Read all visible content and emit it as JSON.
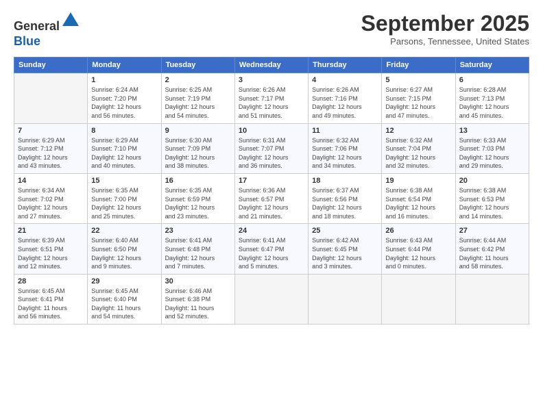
{
  "logo": {
    "line1": "General",
    "line2": "Blue"
  },
  "title": "September 2025",
  "location": "Parsons, Tennessee, United States",
  "days_of_week": [
    "Sunday",
    "Monday",
    "Tuesday",
    "Wednesday",
    "Thursday",
    "Friday",
    "Saturday"
  ],
  "weeks": [
    [
      {
        "day": "",
        "info": ""
      },
      {
        "day": "1",
        "info": "Sunrise: 6:24 AM\nSunset: 7:20 PM\nDaylight: 12 hours\nand 56 minutes."
      },
      {
        "day": "2",
        "info": "Sunrise: 6:25 AM\nSunset: 7:19 PM\nDaylight: 12 hours\nand 54 minutes."
      },
      {
        "day": "3",
        "info": "Sunrise: 6:26 AM\nSunset: 7:17 PM\nDaylight: 12 hours\nand 51 minutes."
      },
      {
        "day": "4",
        "info": "Sunrise: 6:26 AM\nSunset: 7:16 PM\nDaylight: 12 hours\nand 49 minutes."
      },
      {
        "day": "5",
        "info": "Sunrise: 6:27 AM\nSunset: 7:15 PM\nDaylight: 12 hours\nand 47 minutes."
      },
      {
        "day": "6",
        "info": "Sunrise: 6:28 AM\nSunset: 7:13 PM\nDaylight: 12 hours\nand 45 minutes."
      }
    ],
    [
      {
        "day": "7",
        "info": "Sunrise: 6:29 AM\nSunset: 7:12 PM\nDaylight: 12 hours\nand 43 minutes."
      },
      {
        "day": "8",
        "info": "Sunrise: 6:29 AM\nSunset: 7:10 PM\nDaylight: 12 hours\nand 40 minutes."
      },
      {
        "day": "9",
        "info": "Sunrise: 6:30 AM\nSunset: 7:09 PM\nDaylight: 12 hours\nand 38 minutes."
      },
      {
        "day": "10",
        "info": "Sunrise: 6:31 AM\nSunset: 7:07 PM\nDaylight: 12 hours\nand 36 minutes."
      },
      {
        "day": "11",
        "info": "Sunrise: 6:32 AM\nSunset: 7:06 PM\nDaylight: 12 hours\nand 34 minutes."
      },
      {
        "day": "12",
        "info": "Sunrise: 6:32 AM\nSunset: 7:04 PM\nDaylight: 12 hours\nand 32 minutes."
      },
      {
        "day": "13",
        "info": "Sunrise: 6:33 AM\nSunset: 7:03 PM\nDaylight: 12 hours\nand 29 minutes."
      }
    ],
    [
      {
        "day": "14",
        "info": "Sunrise: 6:34 AM\nSunset: 7:02 PM\nDaylight: 12 hours\nand 27 minutes."
      },
      {
        "day": "15",
        "info": "Sunrise: 6:35 AM\nSunset: 7:00 PM\nDaylight: 12 hours\nand 25 minutes."
      },
      {
        "day": "16",
        "info": "Sunrise: 6:35 AM\nSunset: 6:59 PM\nDaylight: 12 hours\nand 23 minutes."
      },
      {
        "day": "17",
        "info": "Sunrise: 6:36 AM\nSunset: 6:57 PM\nDaylight: 12 hours\nand 21 minutes."
      },
      {
        "day": "18",
        "info": "Sunrise: 6:37 AM\nSunset: 6:56 PM\nDaylight: 12 hours\nand 18 minutes."
      },
      {
        "day": "19",
        "info": "Sunrise: 6:38 AM\nSunset: 6:54 PM\nDaylight: 12 hours\nand 16 minutes."
      },
      {
        "day": "20",
        "info": "Sunrise: 6:38 AM\nSunset: 6:53 PM\nDaylight: 12 hours\nand 14 minutes."
      }
    ],
    [
      {
        "day": "21",
        "info": "Sunrise: 6:39 AM\nSunset: 6:51 PM\nDaylight: 12 hours\nand 12 minutes."
      },
      {
        "day": "22",
        "info": "Sunrise: 6:40 AM\nSunset: 6:50 PM\nDaylight: 12 hours\nand 9 minutes."
      },
      {
        "day": "23",
        "info": "Sunrise: 6:41 AM\nSunset: 6:48 PM\nDaylight: 12 hours\nand 7 minutes."
      },
      {
        "day": "24",
        "info": "Sunrise: 6:41 AM\nSunset: 6:47 PM\nDaylight: 12 hours\nand 5 minutes."
      },
      {
        "day": "25",
        "info": "Sunrise: 6:42 AM\nSunset: 6:45 PM\nDaylight: 12 hours\nand 3 minutes."
      },
      {
        "day": "26",
        "info": "Sunrise: 6:43 AM\nSunset: 6:44 PM\nDaylight: 12 hours\nand 0 minutes."
      },
      {
        "day": "27",
        "info": "Sunrise: 6:44 AM\nSunset: 6:42 PM\nDaylight: 11 hours\nand 58 minutes."
      }
    ],
    [
      {
        "day": "28",
        "info": "Sunrise: 6:45 AM\nSunset: 6:41 PM\nDaylight: 11 hours\nand 56 minutes."
      },
      {
        "day": "29",
        "info": "Sunrise: 6:45 AM\nSunset: 6:40 PM\nDaylight: 11 hours\nand 54 minutes."
      },
      {
        "day": "30",
        "info": "Sunrise: 6:46 AM\nSunset: 6:38 PM\nDaylight: 11 hours\nand 52 minutes."
      },
      {
        "day": "",
        "info": ""
      },
      {
        "day": "",
        "info": ""
      },
      {
        "day": "",
        "info": ""
      },
      {
        "day": "",
        "info": ""
      }
    ]
  ]
}
